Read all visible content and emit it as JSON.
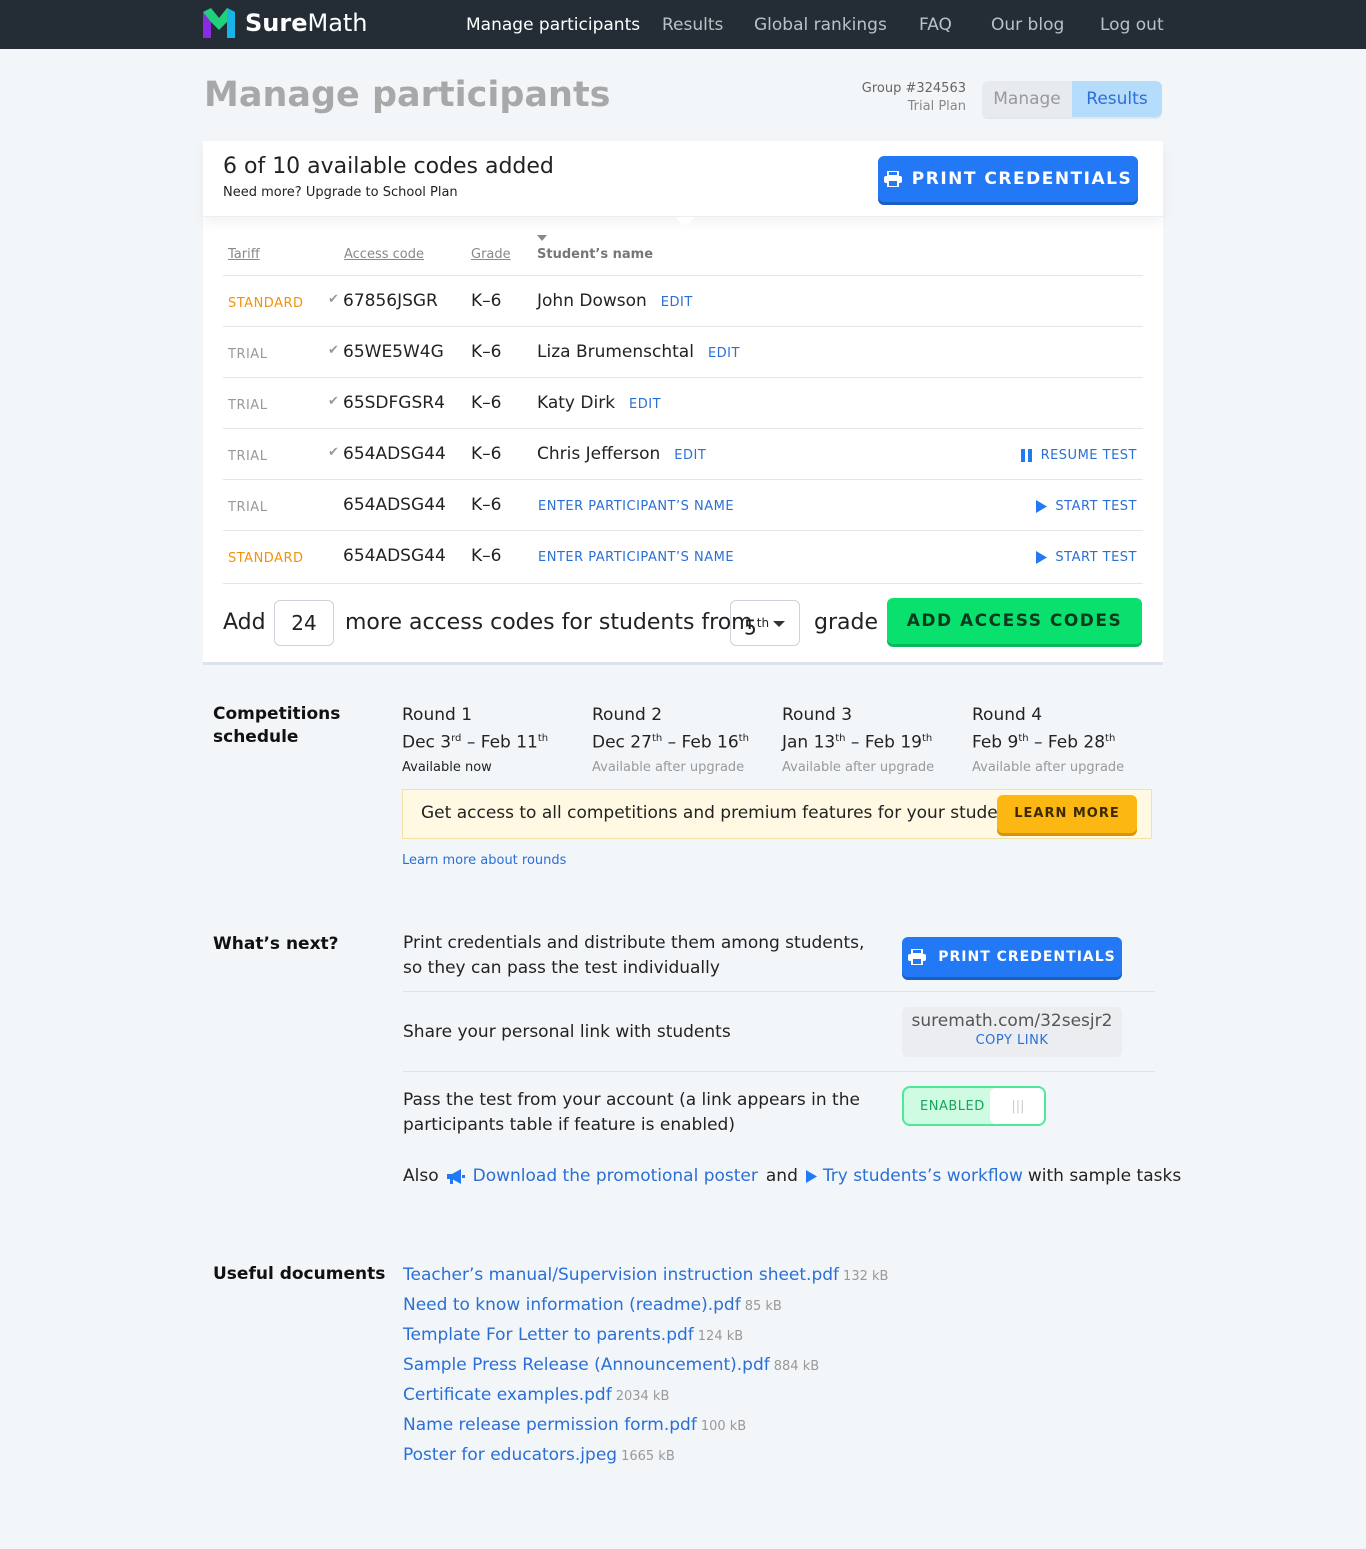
{
  "nav": {
    "brand": {
      "part1": "Sure",
      "part2": "Math"
    },
    "links": [
      "Manage participants",
      "Results",
      "Global rankings",
      "FAQ",
      "Our blog",
      "Log out"
    ]
  },
  "header": {
    "title": "Manage participants",
    "group": "Group #324563",
    "plan": "Trial Plan",
    "seg": [
      "Manage",
      "Results"
    ]
  },
  "codes": {
    "title": "6 of 10 available codes added",
    "need_more": "Need more?",
    "upgrade_link": "Upgrade to School Plan",
    "print_button": "PRINT CREDENTIALS"
  },
  "table": {
    "headers": [
      "Tariff",
      "Access code",
      "Grade",
      "Student’s name"
    ],
    "rows": [
      {
        "tariff": "STANDARD",
        "checked": true,
        "code": "67856JSGR",
        "grade": "K–6",
        "name": "John Dowson",
        "edit": "EDIT",
        "action": ""
      },
      {
        "tariff": "TRIAL",
        "checked": true,
        "code": "65WE5W4G",
        "grade": "K–6",
        "name": "Liza Brumenschtal",
        "edit": "EDIT",
        "action": ""
      },
      {
        "tariff": "TRIAL",
        "checked": true,
        "code": "65SDFGSR4",
        "grade": "K–6",
        "name": "Katy Dirk",
        "edit": "EDIT",
        "action": ""
      },
      {
        "tariff": "TRIAL",
        "checked": true,
        "code": "654ADSG44",
        "grade": "K–6",
        "name": "Chris Jefferson",
        "edit": "EDIT",
        "action": "RESUME TEST"
      },
      {
        "tariff": "TRIAL",
        "checked": false,
        "code": "654ADSG44",
        "grade": "K–6",
        "name": "ENTER PARTICIPANT’S NAME",
        "edit": "",
        "action": "START TEST"
      },
      {
        "tariff": "STANDARD",
        "checked": false,
        "code": "654ADSG44",
        "grade": "K–6",
        "name": "ENTER PARTICIPANT’S NAME",
        "edit": "",
        "action": "START TEST"
      }
    ]
  },
  "add": {
    "prefix": "Add",
    "count": "24",
    "middle": "more access codes for students from",
    "grade": "5",
    "grade_sup": "th",
    "suffix": "grade",
    "button": "ADD ACCESS CODES"
  },
  "competitions": {
    "title": "Competitions schedule",
    "rounds": [
      {
        "name": "Round 1",
        "start": "Dec 3",
        "start_sup": "rd",
        "end": "Feb 11",
        "end_sup": "th",
        "status": "Available now"
      },
      {
        "name": "Round 2",
        "start": "Dec 27",
        "start_sup": "th",
        "end": "Feb 16",
        "end_sup": "th",
        "status": "Available after upgrade"
      },
      {
        "name": "Round 3",
        "start": "Jan 13",
        "start_sup": "th",
        "end": "Feb 19",
        "end_sup": "th",
        "status": "Available after upgrade"
      },
      {
        "name": "Round 4",
        "start": "Feb 9",
        "start_sup": "th",
        "end": "Feb 28",
        "end_sup": "th",
        "status": "Available after upgrade"
      }
    ],
    "promo_text": "Get access to all competitions and premium features for your students",
    "learn_more": "LEARN MORE",
    "learn_rounds": "Learn more about rounds"
  },
  "next": {
    "title": "What’s next?",
    "print_line1": "Print credentials and distribute them among students,",
    "print_line2": "so they can pass the test individually",
    "print_button": "PRINT CREDENTIALS",
    "share_text": "Share your personal link with students",
    "link_url": "suremath.com/32sesjr2",
    "copy_link": "COPY LINK",
    "pass_line1": "Pass the test from your account (a link appears in the",
    "pass_line2": "participants table if feature is enabled)",
    "toggle_label": "ENABLED",
    "also": "Also",
    "poster_link": "Download the promotional poster",
    "and": "and",
    "workflow_link": "Try students’s workflow",
    "sample": "with sample tasks"
  },
  "documents": {
    "title": "Useful documents",
    "items": [
      {
        "name": "Teacher’s manual/Supervision instruction sheet.pdf",
        "size": "132 kB"
      },
      {
        "name": "Need to know information (readme).pdf",
        "size": "85 kB"
      },
      {
        "name": "Template For Letter to parents.pdf",
        "size": "124 kB"
      },
      {
        "name": "Sample Press Release (Announcement).pdf",
        "size": "884 kB"
      },
      {
        "name": "Certificate examples.pdf",
        "size": "2034 kB"
      },
      {
        "name": "Name release permission form.pdf",
        "size": "100 kB"
      },
      {
        "name": "Poster for educators.jpeg",
        "size": "1665 kB"
      }
    ]
  }
}
